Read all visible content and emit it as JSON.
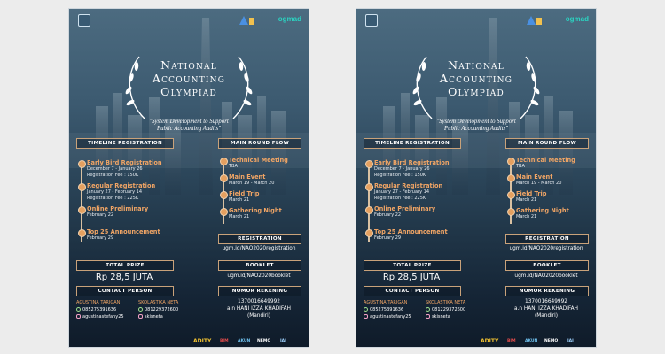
{
  "posters": [
    {
      "brand_logo": "ogmad",
      "title_lines": [
        "National",
        "Accounting",
        "Olympiad"
      ],
      "tagline_lines": [
        "\"System Development to Support",
        "Public Accounting Audits\""
      ],
      "timeline": {
        "header": "TIMELINE REGISTRATION",
        "items": [
          {
            "title": "Early Bird Registration",
            "date": "December 7 - January 26",
            "fee": "Registration Fee : 150K"
          },
          {
            "title": "Regular Registration",
            "date": "January 27 - February 14",
            "fee": "Registration Fee : 225K"
          },
          {
            "title": "Online Preliminary",
            "date": "February 22",
            "fee": ""
          },
          {
            "title": "Top 25 Announcement",
            "date": "February 29",
            "fee": ""
          }
        ]
      },
      "main_round": {
        "header": "MAIN ROUND FLOW",
        "items": [
          {
            "title": "Technical Meeting",
            "date": "TBA"
          },
          {
            "title": "Main Event",
            "date": "March 19 - March 20"
          },
          {
            "title": "Field Trip",
            "date": "March 21"
          },
          {
            "title": "Gathering Night",
            "date": "March 21"
          }
        ]
      },
      "registration": {
        "header": "REGISTRATION",
        "link": "ugm.id/NAO2020registration"
      },
      "booklet": {
        "header": "BOOKLET",
        "link": "ugm.id/NAO2020booklet"
      },
      "total_prize": {
        "header": "TOTAL PRIZE",
        "value": "Rp 28,5 JUTA"
      },
      "contact": {
        "header": "CONTACT PERSON",
        "people": [
          {
            "name": "AGUSTINA TARIGAN",
            "phone": "085275391636",
            "ig": "agustinastefany25"
          },
          {
            "name": "SKOLASTIKA NETA",
            "phone": "081229372600",
            "ig": "skisneta_"
          }
        ]
      },
      "account": {
        "header": "NOMOR REKENING",
        "number": "1370016649992",
        "holder": "a.n HANI IZZA KHADIFAH",
        "bank": "(Mandiri)"
      },
      "sponsors": [
        "ADITY",
        "BIM",
        "AKUN",
        "NEMO",
        "IAI"
      ],
      "colors": {
        "accent": "#f1a565",
        "border": "#c9a27a",
        "bg_top": "#4c6b80",
        "bg_bottom": "#0f1b29"
      }
    },
    {
      "brand_logo": "ogmad",
      "title_lines": [
        "National",
        "Accounting",
        "Olympiad"
      ],
      "tagline_lines": [
        "\"System Development to Support",
        "Public Accounting Audits\""
      ],
      "timeline": {
        "header": "TIMELINE REGISTRATION",
        "items": [
          {
            "title": "Early Bird Registration",
            "date": "December 7 - January 26",
            "fee": "Registration Fee : 150K"
          },
          {
            "title": "Regular Registration",
            "date": "January 27 - February 14",
            "fee": "Registration Fee : 225K"
          },
          {
            "title": "Online Preliminary",
            "date": "February 22",
            "fee": ""
          },
          {
            "title": "Top 25 Announcement",
            "date": "February 29",
            "fee": ""
          }
        ]
      },
      "main_round": {
        "header": "MAIN ROUND FLOW",
        "items": [
          {
            "title": "Technical Meeting",
            "date": "TBA"
          },
          {
            "title": "Main Event",
            "date": "March 19 - March 20"
          },
          {
            "title": "Field Trip",
            "date": "March 21"
          },
          {
            "title": "Gathering Night",
            "date": "March 21"
          }
        ]
      },
      "registration": {
        "header": "REGISTRATION",
        "link": "ugm.id/NAO2020registration"
      },
      "booklet": {
        "header": "BOOKLET",
        "link": "ugm.id/NAO2020booklet"
      },
      "total_prize": {
        "header": "TOTAL PRIZE",
        "value": "Rp 28,5 JUTA"
      },
      "contact": {
        "header": "CONTACT PERSON",
        "people": [
          {
            "name": "AGUSTINA TARIGAN",
            "phone": "085275391636",
            "ig": "agustinastefany25"
          },
          {
            "name": "SKOLASTIKA NETA",
            "phone": "081229372600",
            "ig": "skisneta_"
          }
        ]
      },
      "account": {
        "header": "NOMOR REKENING",
        "number": "1370016649992",
        "holder": "a.n HANI IZZA KHADIFAH",
        "bank": "(Mandiri)"
      },
      "sponsors": [
        "ADITY",
        "BIM",
        "AKUN",
        "NEMO",
        "IAI"
      ],
      "colors": {
        "accent": "#f1a565",
        "border": "#c9a27a",
        "bg_top": "#4c6b80",
        "bg_bottom": "#0f1b29"
      }
    }
  ]
}
